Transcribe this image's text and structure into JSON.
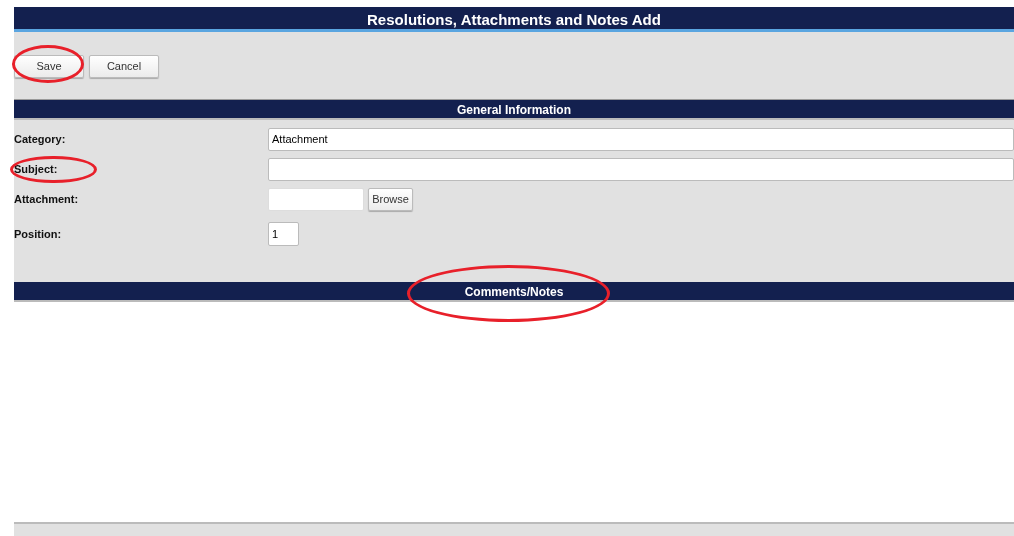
{
  "title": {
    "text": "Resolutions, Attachments and Notes Add"
  },
  "actions": [
    {
      "label": "Save",
      "circled": true
    },
    {
      "label": "Cancel",
      "circled": false
    }
  ],
  "sections": [
    {
      "kind": "form",
      "title": "General Information",
      "circled": false,
      "fields": [
        {
          "kind": "text",
          "label": "Category:",
          "label_circled": false,
          "value": "Attachment"
        },
        {
          "kind": "text",
          "label": "Subject:",
          "label_circled": true
        },
        {
          "kind": "file",
          "label": "Attachment:",
          "label_circled": false,
          "button": "Browse"
        },
        {
          "kind": "number",
          "label": "Position:",
          "label_circled": false,
          "value": "1"
        }
      ]
    },
    {
      "kind": "notes",
      "title": "Comments/Notes",
      "circled": true
    }
  ]
}
